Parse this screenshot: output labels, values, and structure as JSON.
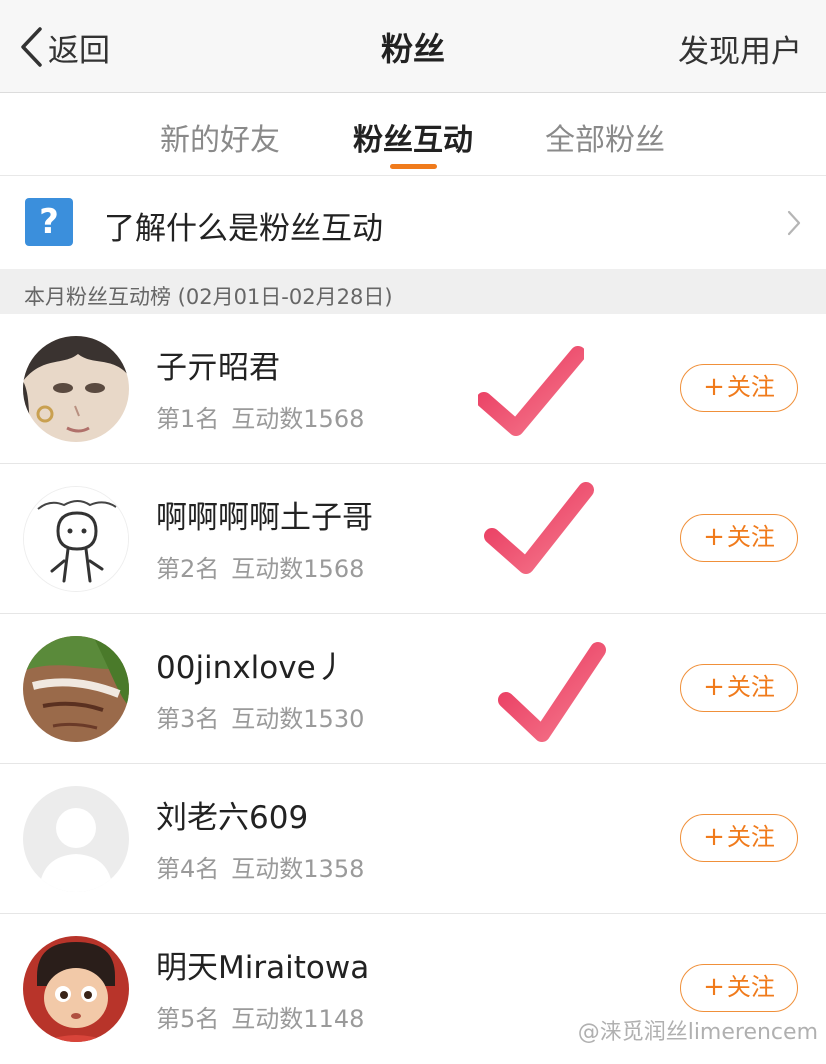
{
  "nav": {
    "back_label": "返回",
    "title": "粉丝",
    "right_action": "发现用户"
  },
  "tabs": [
    {
      "label": "新的好友",
      "active": false
    },
    {
      "label": "粉丝互动",
      "active": true
    },
    {
      "label": "全部粉丝",
      "active": false
    }
  ],
  "info": {
    "icon": "question-icon",
    "icon_glyph": "?",
    "label": "了解什么是粉丝互动"
  },
  "section_header": "本月粉丝互动榜 (02月01日-02月28日)",
  "fans": [
    {
      "name": "子亓昭君",
      "rank": "第1名",
      "interactions": "互动数1568",
      "checked": true,
      "follow_label": "关注"
    },
    {
      "name": "啊啊啊啊土子哥",
      "rank": "第2名",
      "interactions": "互动数1568",
      "checked": true,
      "follow_label": "关注"
    },
    {
      "name": "00jinxlove丿",
      "rank": "第3名",
      "interactions": "互动数1530",
      "checked": true,
      "follow_label": "关注"
    },
    {
      "name": "刘老六609",
      "rank": "第4名",
      "interactions": "互动数1358",
      "checked": false,
      "follow_label": "关注"
    },
    {
      "name": "明天Miraitowa",
      "rank": "第5名",
      "interactions": "互动数1148",
      "checked": false,
      "follow_label": "关注"
    }
  ],
  "watermark": "@涞觅润丝limerencem",
  "colors": {
    "accent": "#f07b1c",
    "help_icon": "#3b8fdc",
    "check": "#e8325a"
  }
}
